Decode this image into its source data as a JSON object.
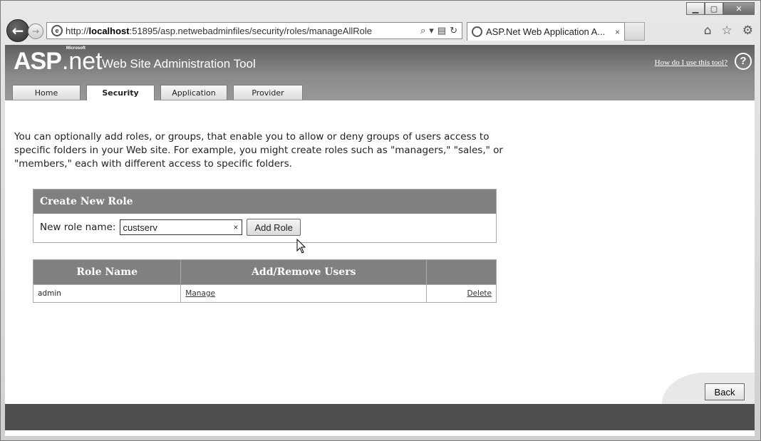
{
  "browser": {
    "url_prefix": "http://",
    "url_host": "localhost",
    "url_rest": ":51895/asp.netwebadminfiles/security/roles/manageAllRole",
    "tab_title": "ASP.Net Web Application A...",
    "tab_close": "×",
    "icons": [
      "back-icon",
      "forward-icon",
      "search-icon",
      "dropdown-icon",
      "compat-icon",
      "refresh-icon",
      "home-icon",
      "favorites-icon",
      "tools-gear-icon"
    ]
  },
  "header": {
    "logo_asp": "ASP",
    "logo_net": ".net",
    "logo_ms": "Microsoft",
    "title": "Web Site Administration Tool",
    "help_link": "How do I use this tool?",
    "help_icon": "?"
  },
  "tabs": [
    {
      "label": "Home",
      "active": false
    },
    {
      "label": "Security",
      "active": true
    },
    {
      "label": "Application",
      "active": false
    },
    {
      "label": "Provider",
      "active": false
    }
  ],
  "intro": "You can optionally add roles, or groups, that enable you to allow or deny groups of users access to specific folders in your Web site. For example, you might create roles such as \"managers,\" \"sales,\" or \"members,\" each with different access to specific folders.",
  "create_role": {
    "heading": "Create New Role",
    "label": "New role name:",
    "value": "custserv",
    "clear": "×",
    "button": "Add Role"
  },
  "roles_table": {
    "headers": [
      "Role Name",
      "Add/Remove Users",
      ""
    ],
    "rows": [
      {
        "name": "admin",
        "manage": "Manage",
        "delete": "Delete"
      }
    ]
  },
  "back_button": "Back"
}
